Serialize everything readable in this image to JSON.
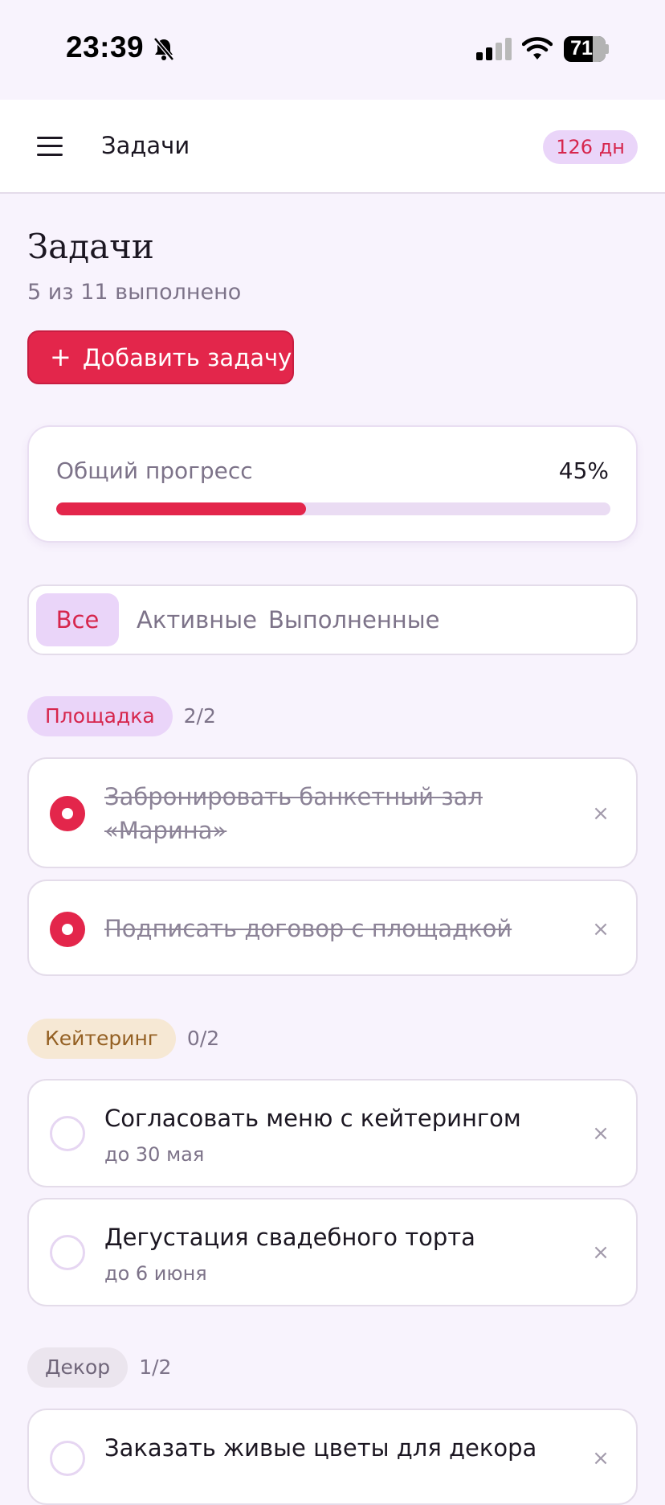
{
  "status_bar": {
    "time": "23:39",
    "battery": "71",
    "icons": [
      "bell-slash-icon",
      "cellular-signal-icon",
      "wifi-icon",
      "battery-icon"
    ]
  },
  "app_bar": {
    "menu_icon": "hamburger-menu-icon",
    "title": "Задачи",
    "days_badge": "126 дн"
  },
  "page": {
    "title": "Задачи",
    "subtitle": "5 из 11 выполнено",
    "add_button": {
      "plus": "+",
      "label": "Добавить задачу"
    }
  },
  "progress": {
    "label": "Общий прогресс",
    "value_text": "45%",
    "fraction": 0.45
  },
  "filters": {
    "all": "Все",
    "active": "Активные",
    "done": "Выполненные",
    "selected": "all"
  },
  "groups": [
    {
      "chip": "Площадка",
      "count": "2/2",
      "colors": {
        "bg": "#ead5f9",
        "fg": "#d6264d"
      },
      "tasks": [
        {
          "text": "Забронировать банкетный зал «Марина»",
          "done": true,
          "remove": "×"
        },
        {
          "text": "Подписать договор с площадкой",
          "done": true,
          "remove": "×"
        }
      ]
    },
    {
      "chip": "Кейтеринг",
      "count": "0/2",
      "colors": {
        "bg": "#f6e8d4",
        "fg": "#946023"
      },
      "tasks": [
        {
          "text": "Согласовать меню с кейтерингом",
          "due": "до 30 мая",
          "done": false,
          "remove": "×"
        },
        {
          "text": "Дегустация свадебного торта",
          "due": "до 6 июня",
          "done": false,
          "remove": "×"
        }
      ]
    },
    {
      "chip": "Декор",
      "count": "1/2",
      "colors": {
        "bg": "#ebe5ee",
        "fg": "#6f6579"
      },
      "tasks": [
        {
          "text": "Заказать живые цветы для декора",
          "done": false,
          "remove": "×"
        }
      ]
    }
  ],
  "colors": {
    "accent": "#e3264b",
    "accent_soft": "#ead5f9",
    "background": "#f8f3fd"
  }
}
